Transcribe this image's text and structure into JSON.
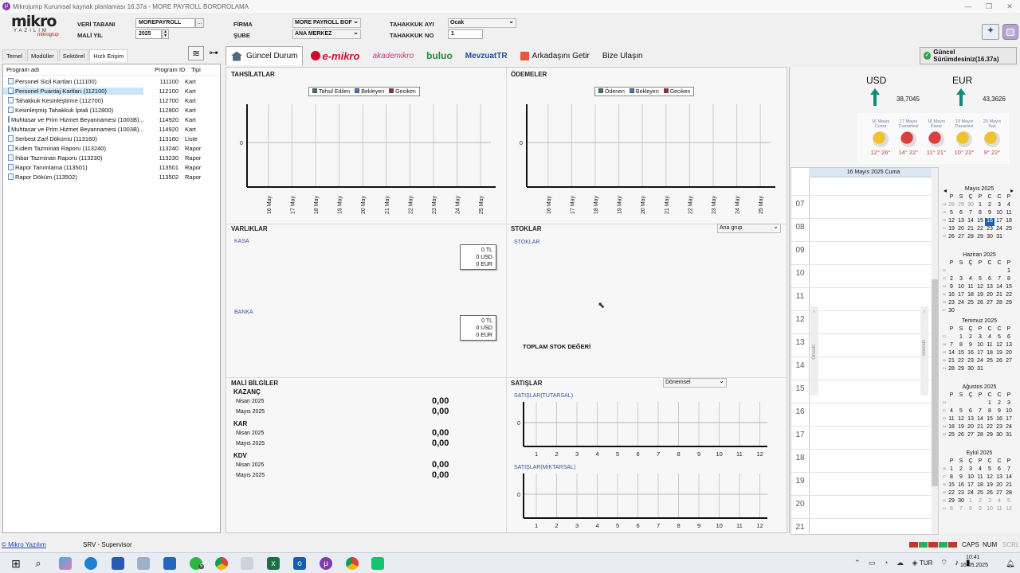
{
  "window": {
    "title": "Mikrojump Kurumsal kaynak planlaması 16.37a - MORE PAYROLL BORDROLAMA",
    "controls": [
      "—",
      "❐",
      "✕"
    ]
  },
  "logo": {
    "main": "mikro",
    "sub": "YAZILIM",
    "group": "mikrogrup"
  },
  "header": {
    "veri_tabani_label": "VERİ TABANI",
    "veri_tabani_value": "MOREPAYROLL",
    "browse_label": "...",
    "mali_yil_label": "MALİ YIL",
    "mali_yil_value": "2025",
    "firma_label": "FİRMA",
    "firma_value": "MORE PAYROLL BOF",
    "sube_label": "ŞUBE",
    "sube_value": "ANA MERKEZ",
    "tahakkuk_ayi_label": "TAHAKKUK AYI",
    "tahakkuk_ayi_value": "Ocak",
    "tahakkuk_no_label": "TAHAKKUK NO",
    "tahakkuk_no_value": "1"
  },
  "left_tabs": [
    "Temel",
    "Modüller",
    "Sektörel",
    "Hızlı Erişim"
  ],
  "left_table": {
    "headers": [
      "Program adı",
      "Program ID",
      "Tipi"
    ],
    "rows": [
      {
        "name": "Personel Sicil Kartları (111100)",
        "id": "111100",
        "type": "Kart"
      },
      {
        "name": "Personel Puantaj Kartları (112100)",
        "id": "112100",
        "type": "Kart"
      },
      {
        "name": "Tahakkuk Kesinleştirme (112700)",
        "id": "112700",
        "type": "Kart"
      },
      {
        "name": "Kesinleşmiş Tahakkuk İptali (112800)",
        "id": "112800",
        "type": "Kart"
      },
      {
        "name": "Muhtasar ve Prim Hizmet Beyannamesi (1003B)...",
        "id": "114920",
        "type": "Kart"
      },
      {
        "name": "Muhtasar ve Prim Hizmet Beyannamesi (1003B)...",
        "id": "114920",
        "type": "Kart"
      },
      {
        "name": "Serbest Zarf Dökümü (113160)",
        "id": "113160",
        "type": "Liste"
      },
      {
        "name": "Kıdem Tazminatı Raporu (113240)",
        "id": "113240",
        "type": "Rapor"
      },
      {
        "name": "İhbar Tazminatı Raporu (113230)",
        "id": "113230",
        "type": "Rapor"
      },
      {
        "name": "Rapor Tanımlama (113501)",
        "id": "113501",
        "type": "Rapor"
      },
      {
        "name": "Rapor Döküm (113502)",
        "id": "113502",
        "type": "Rapor"
      }
    ]
  },
  "tabs": {
    "guncel": "Güncel Durum",
    "emikro": "e-mikro",
    "akademikro": "akademikro",
    "buluo": "buluo",
    "mevzuat": "MevzuatTR",
    "arkadas": "Arkadaşını Getir",
    "bize": "Bize Ulaşın"
  },
  "version_button": "Güncel Sürümdesiniz(16.37a)",
  "tahsilatlar": {
    "title": "TAHSİLATLAR",
    "legend": [
      "Tahsil Edilen",
      "Bekleyen",
      "Geciken"
    ],
    "zero": "0"
  },
  "odemeler": {
    "title": "ÖDEMELER",
    "legend": [
      "Ödenen",
      "Bekleyen",
      "Geciken"
    ],
    "zero": "0"
  },
  "dates": [
    "16 May",
    "17 May",
    "18 May",
    "19 May",
    "20 May",
    "21 May",
    "22 May",
    "23 May",
    "24 May",
    "25 May"
  ],
  "varliklar": {
    "title": "VARLIKLAR",
    "kasa": "KASA",
    "banka": "BANKA",
    "kasa_vals": [
      "0 TL",
      "0 USD",
      "0 EUR"
    ],
    "banka_vals": [
      "0 TL",
      "0 USD",
      "0 EUR"
    ]
  },
  "stoklar": {
    "title": "STOKLAR",
    "dropdown": "Ana grup",
    "sub": "STOKLAR",
    "total": "TOPLAM STOK DEĞERİ"
  },
  "mali": {
    "title": "MALİ BİLGİLER",
    "groups": [
      {
        "name": "KAZANÇ",
        "rows": [
          {
            "m": "Nisan 2025",
            "v": "0,00"
          },
          {
            "m": "Mayıs 2025",
            "v": "0,00"
          }
        ]
      },
      {
        "name": "KAR",
        "rows": [
          {
            "m": "Nisan 2025",
            "v": "0,00"
          },
          {
            "m": "Mayıs 2025",
            "v": "0,00"
          }
        ]
      },
      {
        "name": "KDV",
        "rows": [
          {
            "m": "Nisan 2025",
            "v": "0,00"
          },
          {
            "m": "Mayıs 2025",
            "v": "0,00"
          }
        ]
      }
    ]
  },
  "satislar": {
    "title": "SATIŞLAR",
    "dropdown": "Dönemsel",
    "tutarsal": "SATIŞLAR(TUTARSAL)",
    "miktarsal": "SATIŞLAR(MİKTARSAL)",
    "months": [
      "1",
      "2",
      "3",
      "4",
      "5",
      "6",
      "7",
      "8",
      "9",
      "10",
      "11",
      "12"
    ],
    "zero": "0"
  },
  "currency": {
    "usd_label": "USD",
    "usd_value": "38,7045",
    "eur_label": "EUR",
    "eur_value": "43,3626",
    "arrow_color": "#0f8c7a"
  },
  "weather": [
    {
      "d": "16 Mayıs",
      "w": "Cuma",
      "t": "12° 26°"
    },
    {
      "d": "17 Mayıs",
      "w": "Cumartesi",
      "t": "14° 22°"
    },
    {
      "d": "18 Mayıs",
      "w": "Pazar",
      "t": "11° 21°"
    },
    {
      "d": "19 Mayıs",
      "w": "Pazartesi",
      "t": "10° 22°"
    },
    {
      "d": "20 Mayıs",
      "w": "Salı",
      "t": "9° 22°"
    }
  ],
  "schedule": {
    "date": "16 Mayıs 2025 Cuma",
    "hours": [
      "07",
      "08",
      "09",
      "10",
      "11",
      "12",
      "13",
      "14",
      "15",
      "16",
      "17",
      "18",
      "19",
      "20",
      "21"
    ],
    "prev": "Önceki",
    "next": "Sonraki"
  },
  "calendar": {
    "weekdays": [
      "P",
      "S",
      "Ç",
      "P",
      "C",
      "C",
      "P"
    ],
    "months": [
      {
        "title": "Mayıs 2025",
        "weeks": [
          [
            "18",
            "28",
            "29",
            "30",
            "1",
            "2",
            "3",
            "4"
          ],
          [
            "19",
            "5",
            "6",
            "7",
            "8",
            "9",
            "10",
            "11"
          ],
          [
            "20",
            "12",
            "13",
            "14",
            "15",
            "16",
            "17",
            "18"
          ],
          [
            "21",
            "19",
            "20",
            "21",
            "22",
            "23",
            "24",
            "25"
          ],
          [
            "22",
            "26",
            "27",
            "28",
            "29",
            "30",
            "31",
            ""
          ]
        ]
      },
      {
        "title": "Haziran 2025",
        "weeks": [
          [
            "22",
            "",
            "",
            "",
            "",
            "",
            "",
            "1"
          ],
          [
            "23",
            "2",
            "3",
            "4",
            "5",
            "6",
            "7",
            "8"
          ],
          [
            "24",
            "9",
            "10",
            "11",
            "12",
            "13",
            "14",
            "15"
          ],
          [
            "25",
            "16",
            "17",
            "18",
            "19",
            "20",
            "21",
            "22"
          ],
          [
            "26",
            "23",
            "24",
            "25",
            "26",
            "27",
            "28",
            "29"
          ],
          [
            "27",
            "30",
            "",
            "",
            "",
            "",
            "",
            ""
          ]
        ]
      },
      {
        "title": "Temmuz 2025",
        "weeks": [
          [
            "27",
            "",
            "1",
            "2",
            "3",
            "4",
            "5",
            "6"
          ],
          [
            "28",
            "7",
            "8",
            "9",
            "10",
            "11",
            "12",
            "13"
          ],
          [
            "29",
            "14",
            "15",
            "16",
            "17",
            "18",
            "19",
            "20"
          ],
          [
            "30",
            "21",
            "22",
            "23",
            "24",
            "25",
            "26",
            "27"
          ],
          [
            "31",
            "28",
            "29",
            "30",
            "31",
            "",
            "",
            ""
          ]
        ]
      },
      {
        "title": "Ağustos 2025",
        "weeks": [
          [
            "31",
            "",
            "",
            "",
            "",
            "1",
            "2",
            "3"
          ],
          [
            "32",
            "4",
            "5",
            "6",
            "7",
            "8",
            "9",
            "10"
          ],
          [
            "33",
            "11",
            "12",
            "13",
            "14",
            "15",
            "16",
            "17"
          ],
          [
            "34",
            "18",
            "19",
            "20",
            "21",
            "22",
            "23",
            "24"
          ],
          [
            "35",
            "25",
            "26",
            "27",
            "28",
            "29",
            "30",
            "31"
          ]
        ]
      },
      {
        "title": "Eylül 2025",
        "weeks": [
          [
            "36",
            "1",
            "2",
            "3",
            "4",
            "5",
            "6",
            "7"
          ],
          [
            "37",
            "8",
            "9",
            "10",
            "11",
            "12",
            "13",
            "14"
          ],
          [
            "38",
            "15",
            "16",
            "17",
            "18",
            "19",
            "20",
            "21"
          ],
          [
            "39",
            "22",
            "23",
            "24",
            "25",
            "26",
            "27",
            "28"
          ],
          [
            "40",
            "29",
            "30",
            "1",
            "2",
            "3",
            "4",
            "5"
          ],
          [
            "41",
            "6",
            "7",
            "8",
            "9",
            "10",
            "11",
            "12"
          ]
        ]
      }
    ]
  },
  "status": {
    "link": "© Mikro Yazılım",
    "user": "SRV - Supervisor",
    "caps": "CAPS",
    "num": "NUM",
    "scrl": "SCRL"
  },
  "taskbar": {
    "lang": "TUR",
    "time": "10:41",
    "date": "16.05.2025",
    "badge": "5"
  }
}
